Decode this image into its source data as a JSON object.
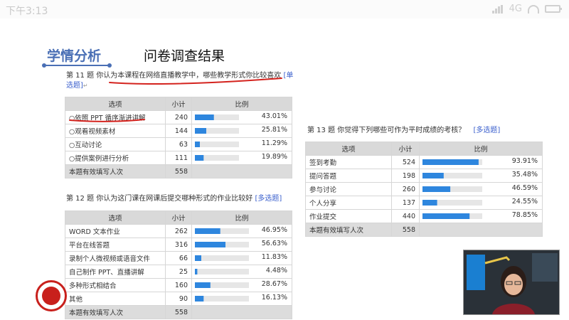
{
  "status": {
    "time": "下午3:13",
    "network": "4G"
  },
  "slide": {
    "title": "学情分析",
    "subtitle": "问卷调查结果"
  },
  "q11": {
    "question": "第 11 题  你认为本课程在网络直播教学中，哪些教学形式你比较喜欢",
    "qtype": "[单选题]",
    "headers": [
      "选项",
      "小计",
      "比例"
    ],
    "rows": [
      {
        "label": "○依照 PPT 循序渐进讲解",
        "count": "240",
        "pct": "43.01%",
        "value": 43.01
      },
      {
        "label": "○观看视频素材",
        "count": "144",
        "pct": "25.81%",
        "value": 25.81
      },
      {
        "label": "○互动讨论",
        "count": "63",
        "pct": "11.29%",
        "value": 11.29
      },
      {
        "label": "○提供案例进行分析",
        "count": "111",
        "pct": "19.89%",
        "value": 19.89
      }
    ],
    "total_label": "本题有效填写人次",
    "total": "558"
  },
  "q12": {
    "question": "第 12 题  你认为这门课在网课后提交哪种形式的作业比较好",
    "qtype": "[多选题]",
    "headers": [
      "选项",
      "小计",
      "比例"
    ],
    "rows": [
      {
        "label": "WORD 文本作业",
        "count": "262",
        "pct": "46.95%",
        "value": 46.95
      },
      {
        "label": "平台在线答题",
        "count": "316",
        "pct": "56.63%",
        "value": 56.63
      },
      {
        "label": "录制个人微视频或语音文件",
        "count": "66",
        "pct": "11.83%",
        "value": 11.83
      },
      {
        "label": "自己制作 PPT、直播讲解",
        "count": "25",
        "pct": "4.48%",
        "value": 4.48
      },
      {
        "label": "多种形式相结合",
        "count": "160",
        "pct": "28.67%",
        "value": 28.67
      },
      {
        "label": "其他",
        "count": "90",
        "pct": "16.13%",
        "value": 16.13
      }
    ],
    "total_label": "本题有效填写人次",
    "total": "558"
  },
  "q13": {
    "question": "第 13 题  你觉得下列哪些可作为平时成绩的考核？",
    "qtype": "[多选题]",
    "headers": [
      "选项",
      "小计",
      "比例"
    ],
    "rows": [
      {
        "label": "签到考勤",
        "count": "524",
        "pct": "93.91%",
        "value": 93.91
      },
      {
        "label": "提问答题",
        "count": "198",
        "pct": "35.48%",
        "value": 35.48
      },
      {
        "label": "参与讨论",
        "count": "260",
        "pct": "46.59%",
        "value": 46.59
      },
      {
        "label": "个人分享",
        "count": "137",
        "pct": "24.55%",
        "value": 24.55
      },
      {
        "label": "作业提交",
        "count": "440",
        "pct": "78.85%",
        "value": 78.85
      }
    ],
    "total_label": "本题有效填写人次",
    "total": "558"
  },
  "colors": {
    "bar": "#2e86de",
    "bar_track": "#e6e6e6",
    "accent": "#4a6fb5",
    "annotation": "#d4231e"
  }
}
